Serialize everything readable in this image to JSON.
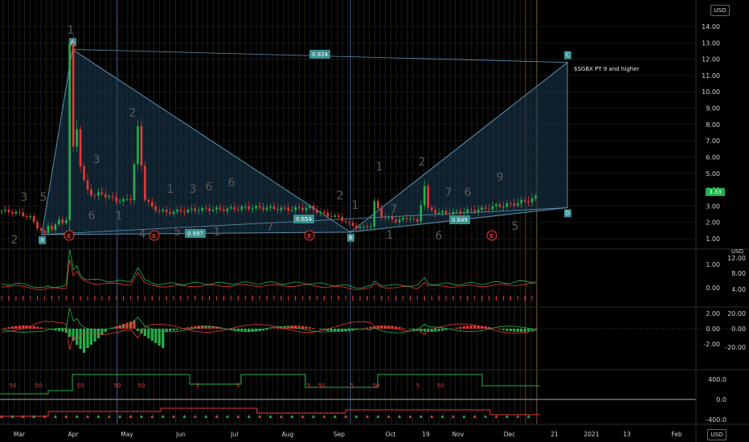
{
  "app": {
    "currency_main": "USD",
    "currency_sub": "USD"
  },
  "colors": {
    "up": "#22b14c",
    "down": "#e53935",
    "pattern_fill": "#1c3a52",
    "pattern_line": "#5a8fb0",
    "tag": "#3a8f8f",
    "bg": "#000000"
  },
  "chart_data": [
    {
      "type": "line",
      "name": "price",
      "ylim": [
        1,
        14
      ],
      "yticks": [
        "14.00",
        "13.00",
        "12.00",
        "11.00",
        "10.00",
        "9.00",
        "8.00",
        "7.00",
        "6.00",
        "5.00",
        "4.00",
        "3.00",
        "2.00",
        "1.00"
      ],
      "xticks": [
        "Mar",
        "Apr",
        "May",
        "Jun",
        "Jul",
        "Aug",
        "Sep",
        "Oct",
        "19",
        "Nov",
        "Dec",
        "21",
        "2021",
        "13",
        "Feb"
      ],
      "last_price": "3.33",
      "series_points": [
        [
          0,
          2.7
        ],
        [
          4,
          2.6
        ],
        [
          8,
          2.3
        ],
        [
          10,
          1.7
        ],
        [
          12,
          1.3
        ],
        [
          13,
          1.8
        ],
        [
          14,
          1.6
        ],
        [
          16,
          2.1
        ],
        [
          17,
          2.0
        ],
        [
          18,
          2.2
        ],
        [
          19,
          12.6
        ],
        [
          20,
          6.5
        ],
        [
          21,
          8.0
        ],
        [
          22,
          5.5
        ],
        [
          23,
          4.4
        ],
        [
          24,
          4.0
        ],
        [
          26,
          3.6
        ],
        [
          28,
          3.8
        ],
        [
          30,
          3.5
        ],
        [
          32,
          3.4
        ],
        [
          34,
          3.3
        ],
        [
          36,
          3.5
        ],
        [
          38,
          7.6
        ],
        [
          40,
          3.5
        ],
        [
          42,
          2.9
        ],
        [
          46,
          2.6
        ],
        [
          50,
          2.7
        ],
        [
          56,
          2.8
        ],
        [
          62,
          2.8
        ],
        [
          68,
          2.9
        ],
        [
          74,
          2.9
        ],
        [
          80,
          2.8
        ],
        [
          86,
          2.9
        ],
        [
          90,
          2.5
        ],
        [
          94,
          2.3
        ],
        [
          97,
          1.9
        ],
        [
          99,
          1.7
        ],
        [
          101,
          1.7
        ],
        [
          103,
          1.8
        ],
        [
          104,
          3.2
        ],
        [
          106,
          2.4
        ],
        [
          110,
          2.1
        ],
        [
          114,
          2.3
        ],
        [
          116,
          2.0
        ],
        [
          118,
          4.3
        ],
        [
          119,
          2.8
        ],
        [
          122,
          2.6
        ],
        [
          126,
          2.6
        ],
        [
          130,
          2.7
        ],
        [
          134,
          2.8
        ],
        [
          138,
          3.0
        ],
        [
          142,
          3.1
        ],
        [
          146,
          3.3
        ],
        [
          149,
          3.5
        ]
      ],
      "harmonic_pattern": {
        "points": [
          {
            "tag": "X",
            "val": 1.25
          },
          {
            "tag": "A",
            "val": 12.6
          },
          {
            "tag": "B",
            "val": 1.4
          },
          {
            "tag": "C",
            "val": 11.8
          },
          {
            "tag": "D",
            "val": 2.9
          }
        ],
        "ratios": [
          "0.924",
          "0.654",
          "0.997",
          "0.849"
        ],
        "note": "$SGBX PT 9 and higher"
      },
      "wave_labels": [
        "2",
        "3",
        "1",
        "5",
        "3",
        "1",
        "6",
        "2",
        "4",
        "5",
        "1",
        "6",
        "3",
        "7",
        "6",
        "1",
        "2",
        "1",
        "1",
        "1",
        "7",
        "2",
        "6",
        "7",
        "6",
        "9",
        "5"
      ],
      "earnings_markers": [
        "E",
        "E",
        "E",
        "E"
      ]
    },
    {
      "type": "line",
      "name": "oscillator",
      "yticks_left": [
        "1.00",
        "0.00"
      ],
      "yticks_right": [
        "12.00",
        "8.00",
        "4.00"
      ]
    },
    {
      "type": "bar",
      "name": "macd",
      "yticks_left": [
        "2.00",
        "0.00",
        "-2.00"
      ],
      "yticks_right": [
        "20.00",
        "0.00",
        "-20.00"
      ]
    },
    {
      "type": "line",
      "name": "signals",
      "yticks": [
        "400.0",
        "0.0",
        "-400.0"
      ],
      "signal_labels": [
        "50",
        "50",
        "50",
        "50",
        "50",
        "5",
        "5",
        "5",
        "50",
        "5",
        "50",
        "5",
        "50"
      ]
    }
  ]
}
